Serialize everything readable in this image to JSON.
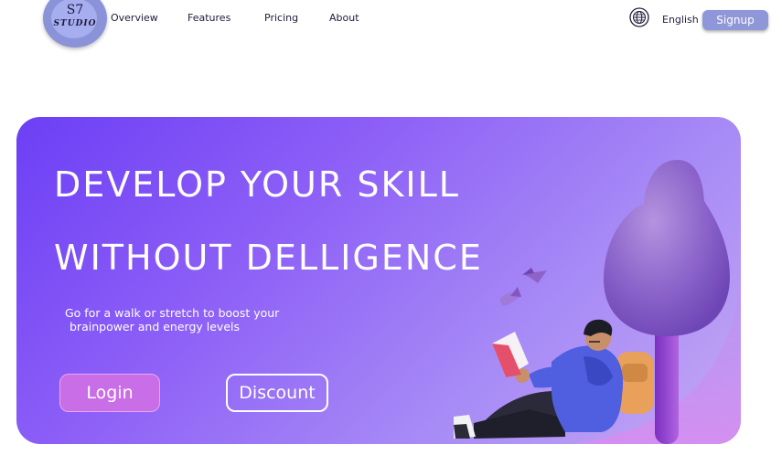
{
  "brand": {
    "logo_top": "S7",
    "logo_bottom": "STUDIO"
  },
  "nav": {
    "links": [
      {
        "label": "Overview"
      },
      {
        "label": "Features"
      },
      {
        "label": "Pricing"
      },
      {
        "label": "About"
      }
    ],
    "language": "English",
    "signup_label": "Signup"
  },
  "hero": {
    "title_line1": "DEVELOP YOUR SKILL",
    "title_line2": "WITHOUT DELLIGENCE",
    "subtitle_line1": "Go for a walk or stretch to boost your",
    "subtitle_line2": "brainpower and energy levels",
    "login_label": "Login",
    "discount_label": "Discount"
  },
  "colors": {
    "hero_start": "#6c3ff5",
    "hero_end": "#c4a6f3",
    "signup_bg": "#8f97d8",
    "login_bg": "#c96ee6"
  },
  "icons": [
    "globe-icon",
    "book-reading-person-illustration",
    "tree-illustration",
    "bird-icon"
  ]
}
